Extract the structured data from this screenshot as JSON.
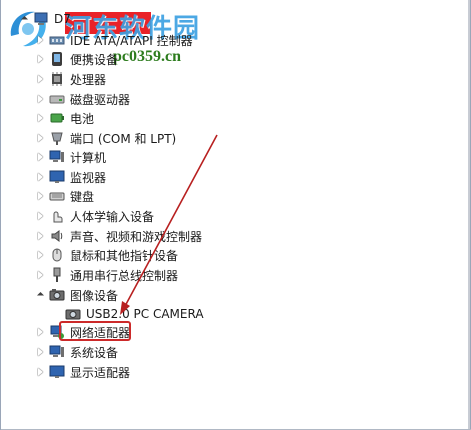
{
  "watermark": {
    "title": "河东软件园",
    "url": "pc0359.cn",
    "logo": "logo-swirl-icon"
  },
  "tree": {
    "root_label": "D7",
    "items": [
      {
        "label": "IDE ATA/ATAPI 控制器",
        "icon": "ide-controller-icon"
      },
      {
        "label": "便携设备",
        "icon": "portable-device-icon"
      },
      {
        "label": "处理器",
        "icon": "processor-icon"
      },
      {
        "label": "磁盘驱动器",
        "icon": "disk-drive-icon"
      },
      {
        "label": "电池",
        "icon": "battery-icon"
      },
      {
        "label": "端口 (COM 和 LPT)",
        "icon": "port-icon"
      },
      {
        "label": "计算机",
        "icon": "computer-icon"
      },
      {
        "label": "监视器",
        "icon": "monitor-icon"
      },
      {
        "label": "键盘",
        "icon": "keyboard-icon"
      },
      {
        "label": "人体学输入设备",
        "icon": "hid-icon"
      },
      {
        "label": "声音、视频和游戏控制器",
        "icon": "sound-icon"
      },
      {
        "label": "鼠标和其他指针设备",
        "icon": "mouse-icon"
      },
      {
        "label": "通用串行总线控制器",
        "icon": "usb-icon"
      },
      {
        "label": "图像设备",
        "icon": "imaging-device-icon",
        "expanded": true
      },
      {
        "label": "USB2.0 PC CAMERA",
        "icon": "camera-icon",
        "child": true
      },
      {
        "label": "网络适配器",
        "icon": "network-adapter-icon",
        "highlighted": true
      },
      {
        "label": "系统设备",
        "icon": "system-device-icon"
      },
      {
        "label": "显示适配器",
        "icon": "display-adapter-icon"
      }
    ]
  },
  "annotation": {
    "box_color": "#cc2a2a",
    "arrow_color": "#b82020"
  }
}
